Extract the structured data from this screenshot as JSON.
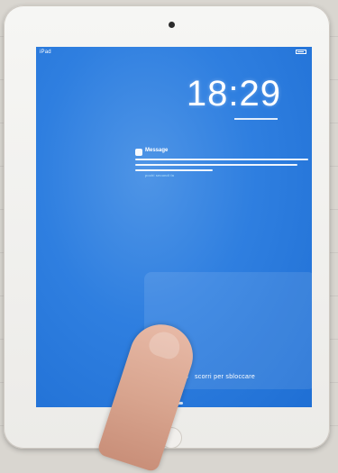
{
  "status_bar": {
    "left_text": "iPad",
    "battery_icon": "battery-icon"
  },
  "lock_screen": {
    "time": "18:29",
    "notification": {
      "app_icon": "app-icon",
      "title": "Message",
      "sub": "pochi secondi fa"
    },
    "slide": {
      "arrow_icon": "chevron-right-icon",
      "text": "scorri per sbloccare"
    }
  },
  "colors": {
    "wallpaper": "#2f7fe0",
    "text": "#ffffff"
  }
}
